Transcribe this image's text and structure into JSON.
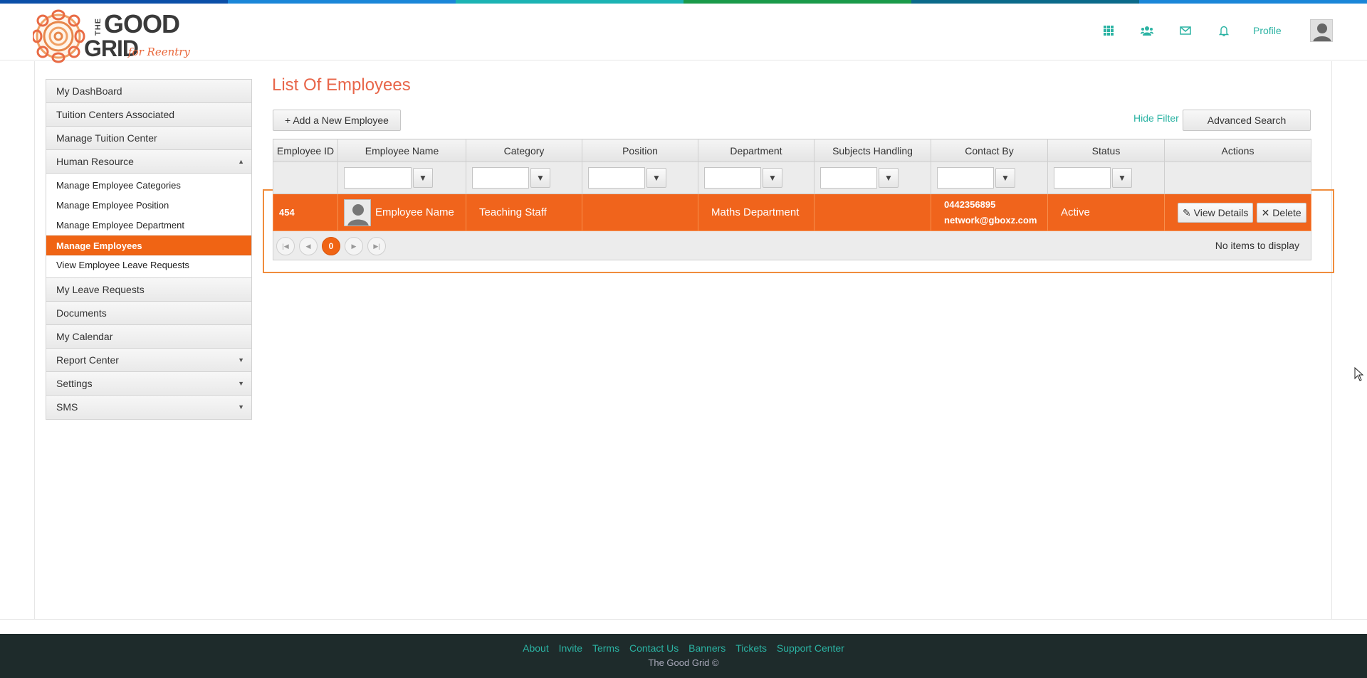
{
  "stripe_colors": [
    "#0b4fa8",
    "#1a86d8",
    "#1bb3b3",
    "#1a9a4a",
    "#0b6a8a",
    "#1a86d8"
  ],
  "brand": {
    "logo_the": "THE",
    "logo_good": "GOOD",
    "logo_grid": "GRID",
    "logo_tagline": "for Reentry",
    "accent_orange": "#f06414",
    "accent_teal": "#2bb3a3"
  },
  "topnav": {
    "icons": [
      "apps-grid-icon",
      "users-icon",
      "mail-icon",
      "bell-icon"
    ],
    "profile_label": "Profile"
  },
  "sidebar": {
    "items": [
      {
        "label": "My DashBoard"
      },
      {
        "label": "Tuition Centers Associated"
      },
      {
        "label": "Manage Tuition Center"
      },
      {
        "label": "Human Resource"
      },
      {
        "label": "My Leave Requests"
      },
      {
        "label": "Documents"
      },
      {
        "label": "My Calendar"
      },
      {
        "label": "Report Center"
      },
      {
        "label": "Settings"
      },
      {
        "label": "SMS"
      }
    ],
    "hr_subitems": [
      {
        "label": "Manage Employee Categories"
      },
      {
        "label": "Manage Employee Position"
      },
      {
        "label": "Manage Employee Department"
      },
      {
        "label": "Manage Employees"
      },
      {
        "label": "View Employee Leave Requests"
      }
    ]
  },
  "main": {
    "title": "List Of Employees",
    "add_button": "Add a New Employee",
    "hide_filter": "Hide Filter",
    "advanced_search": "Advanced Search"
  },
  "grid": {
    "columns": [
      "Employee ID",
      "Employee Name",
      "Category",
      "Position",
      "Department",
      "Subjects Handling",
      "Contact By",
      "Status",
      "Actions"
    ],
    "row": {
      "id": "454",
      "name": "Employee Name",
      "category": "Teaching Staff",
      "position": "",
      "department": "Maths Department",
      "subjects": "",
      "phone": "0442356895",
      "email": "network@gboxz.com",
      "status": "Active",
      "view_label": "View Details",
      "delete_label": "Delete"
    },
    "pager": {
      "current_page": "0",
      "empty_text": "No items to display"
    }
  },
  "footer": {
    "links": [
      "About",
      "Invite",
      "Terms",
      "Contact Us",
      "Banners",
      "Tickets",
      "Support Center"
    ],
    "copyright": "The Good Grid ©"
  }
}
